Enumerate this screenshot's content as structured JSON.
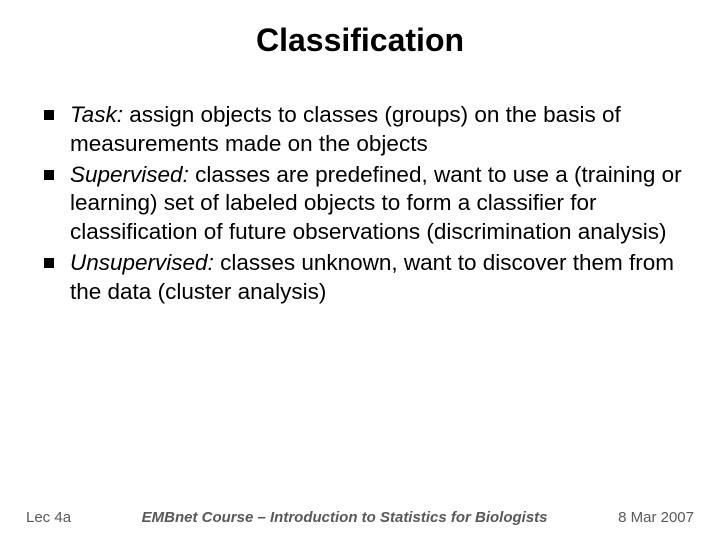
{
  "title": "Classification",
  "bullets": [
    {
      "term": "Task:",
      "text": "  assign objects to classes (groups) on the basis of measurements made on the objects"
    },
    {
      "term": "Supervised:",
      "text": "  classes are predefined, want to use a (training or learning) set of labeled objects to form a classifier for classification of future observations (discrimination analysis)"
    },
    {
      "term": "Unsupervised:",
      "text": "  classes unknown, want to discover them from the data (cluster analysis)"
    }
  ],
  "footer": {
    "left": "Lec 4a",
    "center": "EMBnet Course – Introduction to Statistics for Biologists",
    "right": "8 Mar 2007"
  }
}
